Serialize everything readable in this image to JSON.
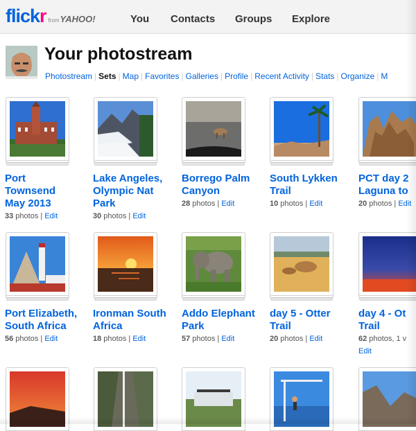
{
  "brand": {
    "logo_main": "flick",
    "logo_accent": "r",
    "logo_from": "from",
    "logo_yahoo": "YAHOO!"
  },
  "nav": {
    "items": [
      "You",
      "Contacts",
      "Groups",
      "Explore"
    ]
  },
  "header": {
    "title": "Your photostream"
  },
  "subnav": {
    "items": [
      "Photostream",
      "Sets",
      "Map",
      "Favorites",
      "Galleries",
      "Profile",
      "Recent Activity",
      "Stats",
      "Organize",
      "M"
    ],
    "active": "Sets"
  },
  "sets": [
    {
      "title1": "Port",
      "title2": "Townsend",
      "title3": "May 2013",
      "count": "33",
      "unit": " photos | ",
      "edit": "Edit"
    },
    {
      "title1": "Lake Angeles,",
      "title2": "Olympic Nat",
      "title3": "Park",
      "count": "30",
      "unit": " photos | ",
      "edit": "Edit"
    },
    {
      "title1": "Borrego Palm",
      "title2": "Canyon",
      "title3": "",
      "count": "28",
      "unit": " photos | ",
      "edit": "Edit"
    },
    {
      "title1": "South Lykken",
      "title2": "Trail",
      "title3": "",
      "count": "10",
      "unit": " photos | ",
      "edit": "Edit"
    },
    {
      "title1": "PCT day 2",
      "title2": "Laguna to",
      "title3": "",
      "count": "20",
      "unit": " photos | ",
      "edit": "Edit"
    },
    {
      "title1": "Port Elizabeth,",
      "title2": "South Africa",
      "title3": "",
      "count": "56",
      "unit": " photos | ",
      "edit": "Edit"
    },
    {
      "title1": "Ironman South",
      "title2": "Africa",
      "title3": "",
      "count": "18",
      "unit": " photos | ",
      "edit": "Edit"
    },
    {
      "title1": "Addo Elephant",
      "title2": "Park",
      "title3": "",
      "count": "57",
      "unit": " photos | ",
      "edit": "Edit"
    },
    {
      "title1": "day 5 - Otter",
      "title2": "Trail",
      "title3": "",
      "count": "20",
      "unit": " photos | ",
      "edit": "Edit"
    },
    {
      "title1": "day 4 - Ot",
      "title2": "Trail",
      "title3": "",
      "count": "62",
      "unit": " photos, 1 v",
      "edit": "Edit"
    }
  ]
}
